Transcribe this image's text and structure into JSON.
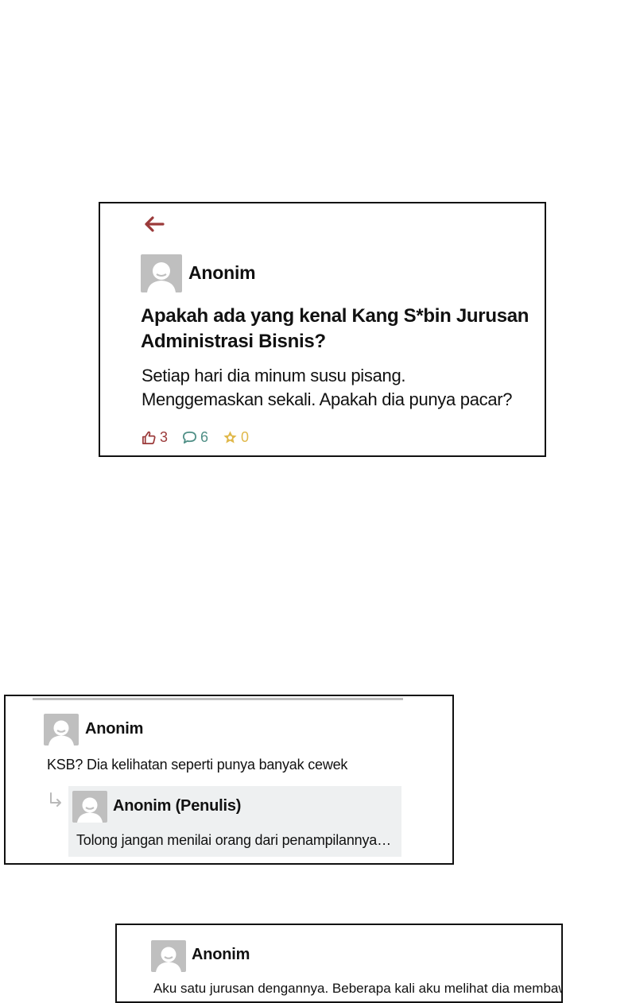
{
  "post": {
    "author": "Anonim",
    "title_line1": "Apakah ada yang kenal Kang S*bin Jurusan",
    "title_line2": "Administrasi Bisnis?",
    "body_line1": "Setiap hari dia minum susu pisang.",
    "body_line2": "Menggemaskan sekali. Apakah dia punya pacar?",
    "likes": "3",
    "comments": "6",
    "scraps": "0",
    "like_color": "#9b3a3a",
    "comment_color": "#4f8f86",
    "scrap_color": "#e0b84a",
    "icons": {
      "back": "arrow-left-icon",
      "like": "thumbs-up-icon",
      "comment": "speech-bubble-icon",
      "scrap": "star-icon"
    }
  },
  "comment": {
    "author": "Anonim",
    "text": "KSB? Dia kelihatan seperti punya banyak cewek",
    "reply": {
      "author": "Anonim (Penulis)",
      "text": "Tolong jangan menilai orang dari penampilannya…"
    }
  },
  "comment2": {
    "author": "Anonim",
    "text": "Aku satu jurusan dengannya. Beberapa kali aku melihat dia membawa"
  }
}
